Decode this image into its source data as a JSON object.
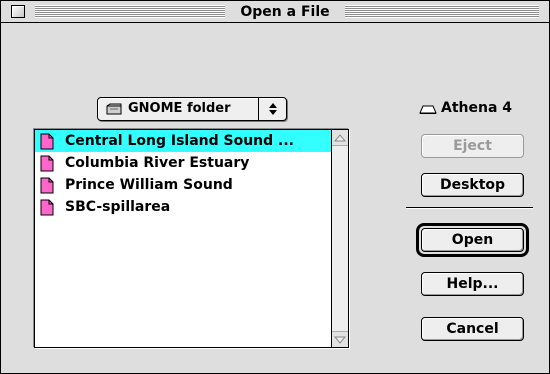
{
  "window": {
    "title": "Open a File"
  },
  "folder_popup": {
    "icon": "folder-icon",
    "label": "GNOME folder",
    "arrows": "up-down-arrows-icon"
  },
  "file_list": {
    "items": [
      {
        "label": "Central Long Island Sound ...",
        "icon": "document-icon",
        "selected": true
      },
      {
        "label": "Columbia River Estuary",
        "icon": "document-icon",
        "selected": false
      },
      {
        "label": "Prince William Sound",
        "icon": "document-icon",
        "selected": false
      },
      {
        "label": "SBC-spillarea",
        "icon": "document-icon",
        "selected": false
      }
    ]
  },
  "volume": {
    "icon": "disk-icon",
    "label": "Athena 4"
  },
  "buttons": {
    "eject": "Eject",
    "desktop": "Desktop",
    "open": "Open",
    "help": "Help...",
    "cancel": "Cancel"
  },
  "colors": {
    "selection": "#33ffff",
    "document_icon": "#ff66cc",
    "window_bg": "#dedede"
  }
}
